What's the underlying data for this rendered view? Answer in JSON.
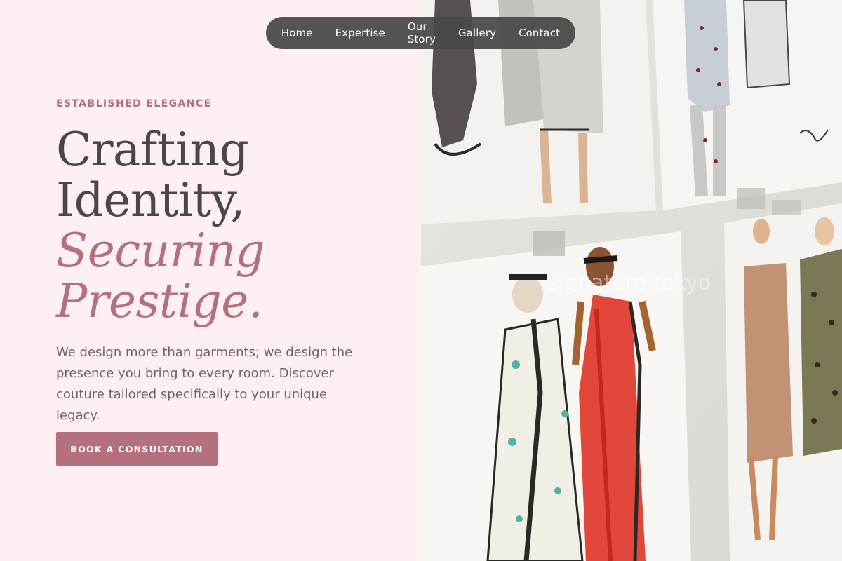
{
  "nav": {
    "items": [
      "Home",
      "Expertise",
      "Our Story",
      "Gallery",
      "Contact"
    ]
  },
  "hero": {
    "eyebrow": "ESTABLISHED ELEGANCE",
    "headline_line1": "Crafting",
    "headline_line2": "Identity,",
    "headline_line3": "Securing",
    "headline_line4": "Prestige.",
    "intro": "We design more than garments; we design the presence you bring to every room. Discover couture tailored specifically to your unique legacy.",
    "cta_label": "BOOK A CONSULTATION"
  },
  "image": {
    "alt": "Watercolor fashion sketches pinned to a wall",
    "watermark": "signature.tokyo"
  },
  "colors": {
    "accent": "#b4707d",
    "background": "#fdeff4",
    "text_dark": "#4a4748",
    "nav_bg": "#484848"
  }
}
